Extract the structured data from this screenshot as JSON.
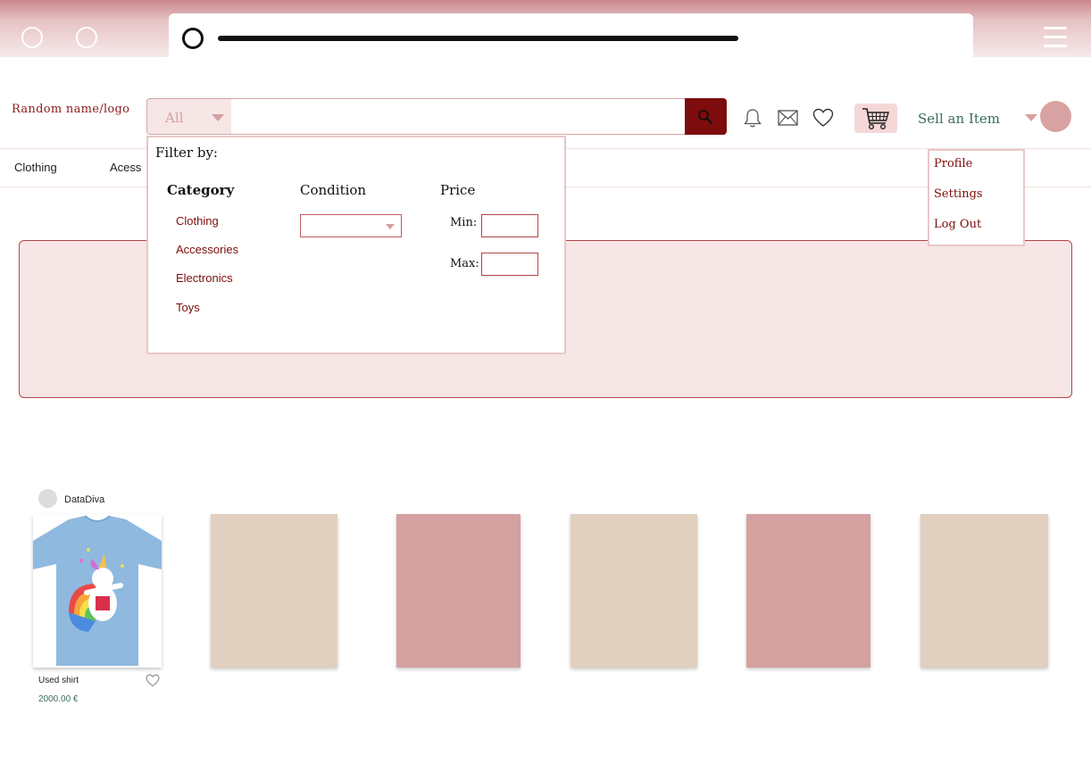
{
  "header": {
    "logo": "Random name/logo",
    "search_scope": "All",
    "sell_label": "Sell an Item"
  },
  "nav": {
    "items": [
      "Clothing",
      "Acess"
    ]
  },
  "filter": {
    "title": "Filter by:",
    "category_heading": "Category",
    "categories": [
      "Clothing",
      "Accessories",
      "Electronics",
      "Toys"
    ],
    "condition_heading": "Condition",
    "condition_value": "",
    "price_heading": "Price",
    "min_label": "Min:",
    "max_label": "Max:"
  },
  "profile_menu": {
    "items": [
      "Profile",
      "Settings",
      "Log Out"
    ]
  },
  "products": {
    "seller": "DataDiva",
    "featured": {
      "name": "Used shirt",
      "price": "2000.00 €"
    },
    "placeholder_colors": [
      "#e1d0bf",
      "#d4a0a0",
      "#e1d0bf",
      "#d4a0a0",
      "#e1d0bf"
    ]
  },
  "colors": {
    "accent": "#7d0c0c",
    "chrome": "#c9868c",
    "banner_bg": "#f6e6e6",
    "price_text": "#3b6b5e"
  }
}
